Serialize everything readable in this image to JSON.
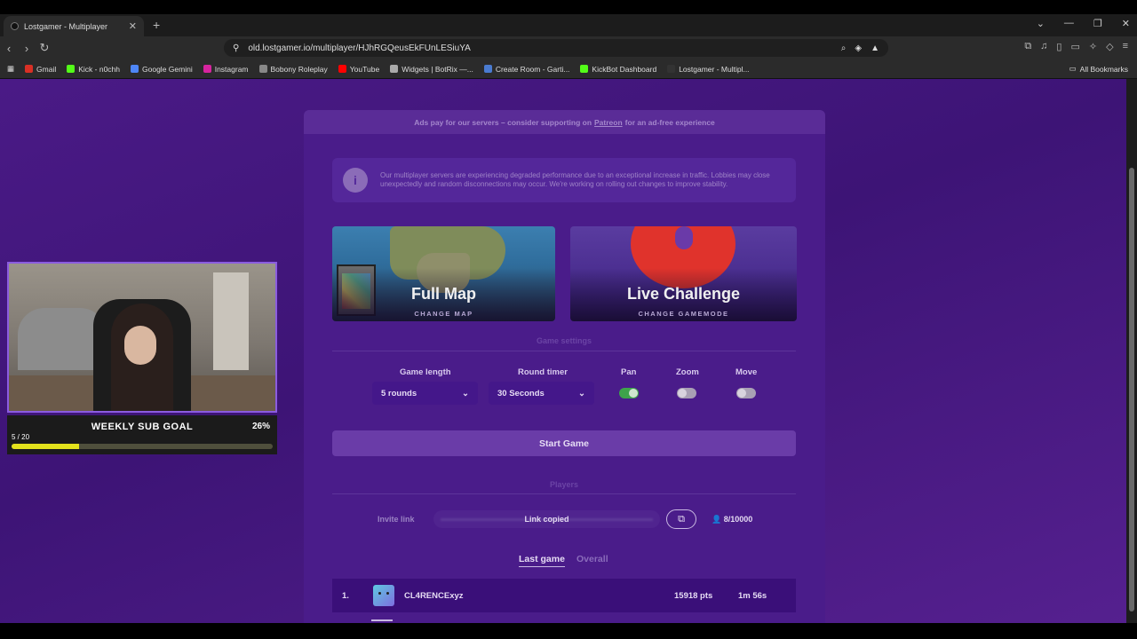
{
  "browser": {
    "tab_title": "Lostgamer - Multiplayer",
    "tab_close": "✕",
    "new_tab": "+",
    "url": "old.lostgamer.io/multiplayer/HJhRGQeusEkFUnLESiuYA",
    "window_controls": [
      "⌄",
      "—",
      "❐",
      "✕"
    ],
    "bookmarks": [
      {
        "label": "Gmail",
        "color": "#d93025"
      },
      {
        "label": "Kick - n0chh",
        "color": "#53fc18"
      },
      {
        "label": "Google Gemini",
        "color": "#4e86f7"
      },
      {
        "label": "Instagram",
        "color": "#d6249f"
      },
      {
        "label": "Bobony Roleplay",
        "color": "#888888"
      },
      {
        "label": "YouTube",
        "color": "#ff0000"
      },
      {
        "label": "Widgets | BotRix —...",
        "color": "#aaaaaa"
      },
      {
        "label": "Create Room - Garti...",
        "color": "#4a7bd0"
      },
      {
        "label": "KickBot Dashboard",
        "color": "#53fc18"
      },
      {
        "label": "Lostgamer - Multipl...",
        "color": "#333333"
      }
    ],
    "all_bookmarks": "All Bookmarks"
  },
  "page": {
    "ad_text_pre": "Ads pay for our servers – consider supporting on",
    "ad_link": "Patreon",
    "ad_text_post": "for an ad-free experience",
    "notice_icon": "i",
    "notice_text": "Our multiplayer servers are experiencing degraded performance due to an exceptional increase in traffic. Lobbies may close unexpectedly and random disconnections may occur. We're working on rolling out changes to improve stability.",
    "map_card": {
      "title": "Full Map",
      "subtitle": "CHANGE MAP"
    },
    "mode_card": {
      "title": "Live Challenge",
      "subtitle": "CHANGE GAMEMODE"
    },
    "settings_header": "Game settings",
    "game_length_label": "Game length",
    "game_length_value": "5 rounds",
    "round_timer_label": "Round timer",
    "round_timer_value": "30 Seconds",
    "pan_label": "Pan",
    "zoom_label": "Zoom",
    "move_label": "Move",
    "toggles": {
      "pan": true,
      "zoom": false,
      "move": false
    },
    "start_button": "Start Game",
    "players_header": "Players",
    "invite_label": "Invite link",
    "link_status": "Link copied",
    "copy_icon": "⧉",
    "player_count": "👤 8/10000",
    "tabs": {
      "last": "Last game",
      "overall": "Overall"
    },
    "leaderboard": [
      {
        "rank": "1.",
        "name": "CL4RENCExyz",
        "points": "15918 pts",
        "time": "1m 56s"
      }
    ]
  },
  "overlay": {
    "goal_label": "WEEKLY SUB GOAL",
    "goal_percent": "26%",
    "goal_count": "5 / 20",
    "goal_progress": 0.26
  },
  "colors": {
    "page_bg": "#4a1a86",
    "accent": "#6a3ca8",
    "toggle_on": "#3ea34b",
    "goal_bar": "#e3e21c"
  }
}
